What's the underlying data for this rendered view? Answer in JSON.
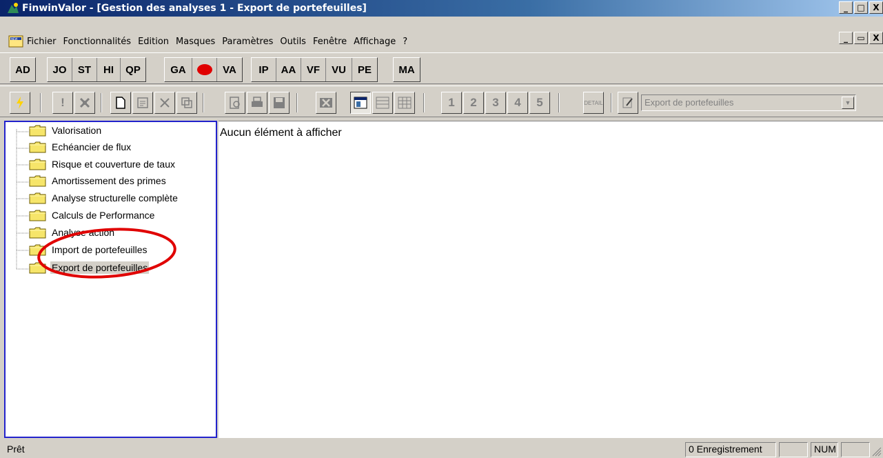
{
  "window": {
    "title": "FinwinValor - [Gestion des analyses 1  -  Export de portefeuilles]",
    "controls": [
      "_",
      "□",
      "X"
    ],
    "mdi_controls": [
      "_",
      "▭",
      "X"
    ]
  },
  "menubar": {
    "items": [
      "Fichier",
      "Fonctionnalités",
      "Edition",
      "Masques",
      "Paramètres",
      "Outils",
      "Fenêtre",
      "Affichage",
      "?"
    ]
  },
  "toolbar1": {
    "groups": [
      [
        "AD"
      ],
      [
        "JO",
        "ST",
        "HI",
        "QP"
      ],
      [
        "GA",
        "",
        "VA"
      ],
      [
        "IP",
        "AA",
        "VF",
        "VU",
        "PE"
      ],
      [
        "MA"
      ]
    ]
  },
  "toolbar2": {
    "number_buttons": [
      "1",
      "2",
      "3",
      "4",
      "5"
    ],
    "detail_label": "DETAIL",
    "combo_value": "Export de portefeuilles"
  },
  "tree": {
    "items": [
      {
        "label": "Valorisation",
        "selected": false
      },
      {
        "label": "Echéancier de flux",
        "selected": false
      },
      {
        "label": "Risque et couverture de taux",
        "selected": false
      },
      {
        "label": "Amortissement des primes",
        "selected": false
      },
      {
        "label": "Analyse structurelle complète",
        "selected": false
      },
      {
        "label": "Calculs de Performance",
        "selected": false
      },
      {
        "label": "Analyse action",
        "selected": false
      },
      {
        "label": "Import de portefeuilles",
        "selected": false
      },
      {
        "label": "Export de portefeuilles",
        "selected": true
      }
    ]
  },
  "main": {
    "empty_message": "Aucun élément à afficher"
  },
  "statusbar": {
    "text": "Prêt",
    "records": "0 Enregistrement",
    "num": "NUM"
  },
  "colors": {
    "title_gradient_start": "#0a246a",
    "title_gradient_end": "#a6caf0",
    "panel_border": "#2222cc",
    "annotation_red": "#e00000",
    "record_dot": "#e00000"
  }
}
